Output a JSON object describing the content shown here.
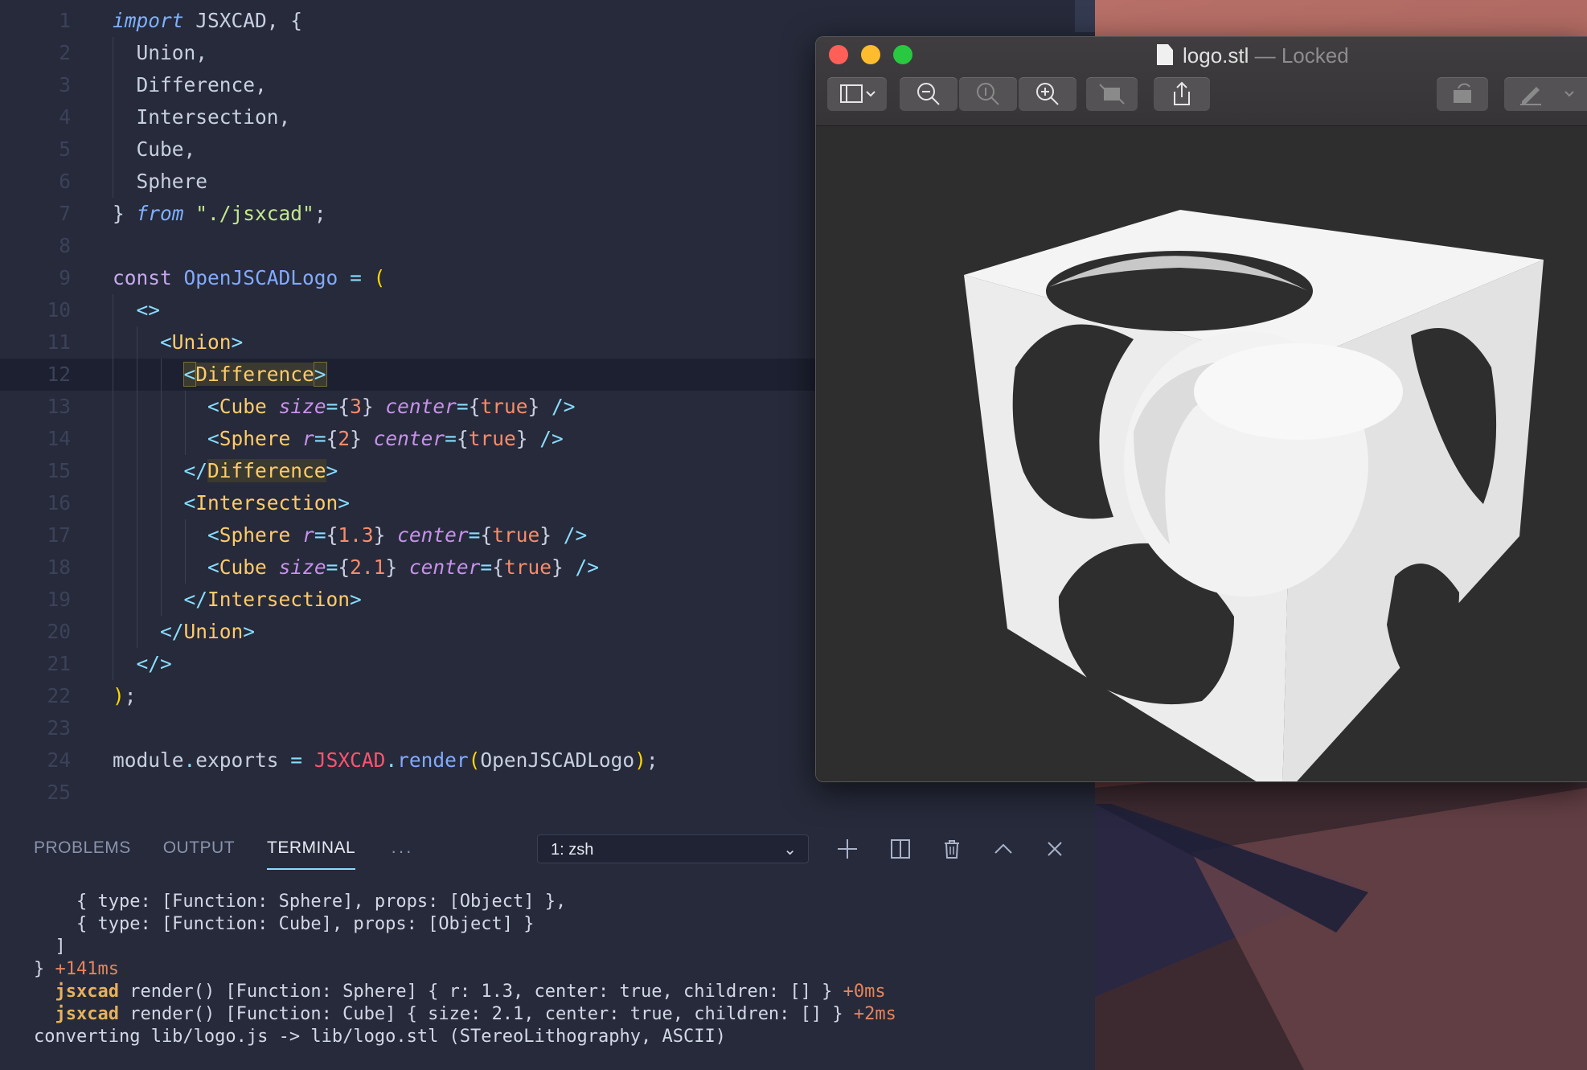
{
  "editor": {
    "lines": [
      {
        "n": "1",
        "tokens": [
          [
            "kw-i",
            "import"
          ],
          [
            "id",
            " JSXCAD, {"
          ]
        ]
      },
      {
        "n": "2",
        "tokens": [
          [
            "id",
            "  Union,"
          ]
        ]
      },
      {
        "n": "3",
        "tokens": [
          [
            "id",
            "  Difference,"
          ]
        ]
      },
      {
        "n": "4",
        "tokens": [
          [
            "id",
            "  Intersection,"
          ]
        ]
      },
      {
        "n": "5",
        "tokens": [
          [
            "id",
            "  Cube,"
          ]
        ]
      },
      {
        "n": "6",
        "tokens": [
          [
            "id",
            "  Sphere"
          ]
        ]
      },
      {
        "n": "7",
        "tokens": [
          [
            "id",
            "} "
          ],
          [
            "kw-i",
            "from"
          ],
          [
            "id",
            " "
          ],
          [
            "str",
            "\"./jsxcad\""
          ],
          [
            "id",
            ";"
          ]
        ]
      },
      {
        "n": "8",
        "tokens": []
      },
      {
        "n": "9",
        "tokens": [
          [
            "kw",
            "const"
          ],
          [
            "id",
            " "
          ],
          [
            "var",
            "OpenJSCADLogo"
          ],
          [
            "id",
            " "
          ],
          [
            "punc",
            "="
          ],
          [
            "id",
            " "
          ],
          [
            "paren",
            "("
          ]
        ]
      },
      {
        "n": "10",
        "tokens": [
          [
            "id",
            "  "
          ],
          [
            "punc",
            "<>"
          ]
        ]
      },
      {
        "n": "11",
        "tokens": [
          [
            "id",
            "    "
          ],
          [
            "punc",
            "<"
          ],
          [
            "tag",
            "Union"
          ],
          [
            "punc",
            ">"
          ]
        ]
      },
      {
        "n": "12",
        "tokens": [
          [
            "id",
            "      "
          ],
          [
            "punc",
            "<"
          ],
          [
            "tag",
            "Difference"
          ],
          [
            "punc",
            ">"
          ]
        ]
      },
      {
        "n": "13",
        "tokens": [
          [
            "id",
            "        "
          ],
          [
            "punc",
            "<"
          ],
          [
            "tag",
            "Cube"
          ],
          [
            "id",
            " "
          ],
          [
            "attr",
            "size"
          ],
          [
            "punc",
            "="
          ],
          [
            "id",
            "{"
          ],
          [
            "num",
            "3"
          ],
          [
            "id",
            "}"
          ],
          [
            "id",
            " "
          ],
          [
            "attr",
            "center"
          ],
          [
            "punc",
            "="
          ],
          [
            "id",
            "{"
          ],
          [
            "bool",
            "true"
          ],
          [
            "id",
            "}"
          ],
          [
            "id",
            " "
          ],
          [
            "punc",
            "/>"
          ]
        ]
      },
      {
        "n": "14",
        "tokens": [
          [
            "id",
            "        "
          ],
          [
            "punc",
            "<"
          ],
          [
            "tag",
            "Sphere"
          ],
          [
            "id",
            " "
          ],
          [
            "attr",
            "r"
          ],
          [
            "punc",
            "="
          ],
          [
            "id",
            "{"
          ],
          [
            "num",
            "2"
          ],
          [
            "id",
            "}"
          ],
          [
            "id",
            " "
          ],
          [
            "attr",
            "center"
          ],
          [
            "punc",
            "="
          ],
          [
            "id",
            "{"
          ],
          [
            "bool",
            "true"
          ],
          [
            "id",
            "}"
          ],
          [
            "id",
            " "
          ],
          [
            "punc",
            "/>"
          ]
        ]
      },
      {
        "n": "15",
        "tokens": [
          [
            "id",
            "      "
          ],
          [
            "punc",
            "</"
          ],
          [
            "tag",
            "Difference"
          ],
          [
            "punc",
            ">"
          ]
        ]
      },
      {
        "n": "16",
        "tokens": [
          [
            "id",
            "      "
          ],
          [
            "punc",
            "<"
          ],
          [
            "tag",
            "Intersection"
          ],
          [
            "punc",
            ">"
          ]
        ]
      },
      {
        "n": "17",
        "tokens": [
          [
            "id",
            "        "
          ],
          [
            "punc",
            "<"
          ],
          [
            "tag",
            "Sphere"
          ],
          [
            "id",
            " "
          ],
          [
            "attr",
            "r"
          ],
          [
            "punc",
            "="
          ],
          [
            "id",
            "{"
          ],
          [
            "num",
            "1.3"
          ],
          [
            "id",
            "}"
          ],
          [
            "id",
            " "
          ],
          [
            "attr",
            "center"
          ],
          [
            "punc",
            "="
          ],
          [
            "id",
            "{"
          ],
          [
            "bool",
            "true"
          ],
          [
            "id",
            "}"
          ],
          [
            "id",
            " "
          ],
          [
            "punc",
            "/>"
          ]
        ]
      },
      {
        "n": "18",
        "tokens": [
          [
            "id",
            "        "
          ],
          [
            "punc",
            "<"
          ],
          [
            "tag",
            "Cube"
          ],
          [
            "id",
            " "
          ],
          [
            "attr",
            "size"
          ],
          [
            "punc",
            "="
          ],
          [
            "id",
            "{"
          ],
          [
            "num",
            "2.1"
          ],
          [
            "id",
            "}"
          ],
          [
            "id",
            " "
          ],
          [
            "attr",
            "center"
          ],
          [
            "punc",
            "="
          ],
          [
            "id",
            "{"
          ],
          [
            "bool",
            "true"
          ],
          [
            "id",
            "}"
          ],
          [
            "id",
            " "
          ],
          [
            "punc",
            "/>"
          ]
        ]
      },
      {
        "n": "19",
        "tokens": [
          [
            "id",
            "      "
          ],
          [
            "punc",
            "</"
          ],
          [
            "tag",
            "Intersection"
          ],
          [
            "punc",
            ">"
          ]
        ]
      },
      {
        "n": "20",
        "tokens": [
          [
            "id",
            "    "
          ],
          [
            "punc",
            "</"
          ],
          [
            "tag",
            "Union"
          ],
          [
            "punc",
            ">"
          ]
        ]
      },
      {
        "n": "21",
        "tokens": [
          [
            "id",
            "  "
          ],
          [
            "punc",
            "</>"
          ]
        ]
      },
      {
        "n": "22",
        "tokens": [
          [
            "paren",
            ")"
          ],
          [
            "id",
            ";"
          ]
        ]
      },
      {
        "n": "23",
        "tokens": []
      },
      {
        "n": "24",
        "tokens": [
          [
            "id",
            "module"
          ],
          [
            "punc",
            "."
          ],
          [
            "id",
            "exports "
          ],
          [
            "punc",
            "="
          ],
          [
            "id",
            " "
          ],
          [
            "red",
            "JSXCAD"
          ],
          [
            "punc",
            "."
          ],
          [
            "var",
            "render"
          ],
          [
            "paren",
            "("
          ],
          [
            "id",
            "OpenJSCADLogo"
          ],
          [
            "paren",
            ")"
          ],
          [
            "id",
            ";"
          ]
        ]
      },
      {
        "n": "25",
        "tokens": []
      }
    ]
  },
  "panel": {
    "tabs": [
      "PROBLEMS",
      "OUTPUT",
      "TERMINAL"
    ],
    "active_tab": "TERMINAL",
    "more": "···",
    "terminal_select": "1: zsh",
    "terminal_lines": [
      [
        [
          "",
          "    { type: [Function: Sphere], props: [Object] },"
        ]
      ],
      [
        [
          "",
          "    { type: [Function: Cube], props: [Object] }"
        ]
      ],
      [
        [
          "",
          "  ]"
        ]
      ],
      [
        [
          "",
          "} "
        ],
        [
          "t-ms",
          "+141ms"
        ]
      ],
      [
        [
          "",
          "  "
        ],
        [
          "t-yellow",
          "jsxcad"
        ],
        [
          "",
          " render() [Function: Sphere] { r: 1.3, center: true, children: [] } "
        ],
        [
          "t-ms",
          "+0ms"
        ]
      ],
      [
        [
          "",
          "  "
        ],
        [
          "t-yellow",
          "jsxcad"
        ],
        [
          "",
          " render() [Function: Cube] { size: 2.1, center: true, children: [] } "
        ],
        [
          "t-ms",
          "+2ms"
        ]
      ],
      [
        [
          "",
          "converting lib/logo.js -> lib/logo.stl (STereoLithography, ASCII)"
        ]
      ]
    ]
  },
  "preview": {
    "filename": "logo.stl",
    "status": " — Locked",
    "colors": {
      "close": "#fe5f57",
      "minimize": "#febc2e",
      "zoom": "#28c840"
    }
  }
}
